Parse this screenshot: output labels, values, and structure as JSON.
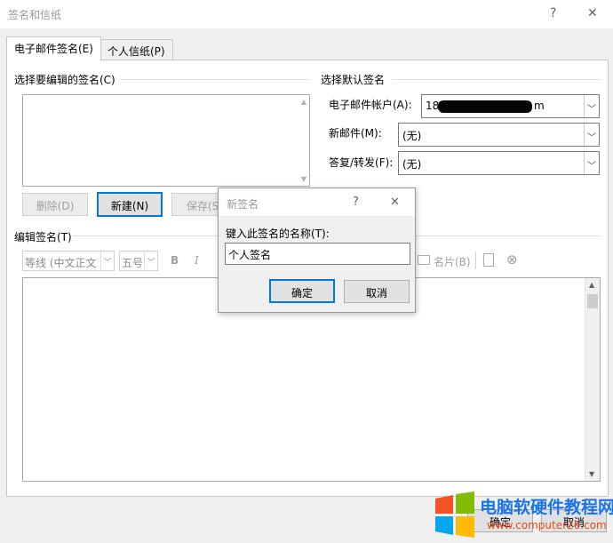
{
  "window": {
    "title": "签名和信纸",
    "help": "?",
    "close": "✕"
  },
  "tabs": [
    {
      "label": "电子邮件签名(E)",
      "active": true
    },
    {
      "label": "个人信纸(P)",
      "active": false
    }
  ],
  "left_section": {
    "heading": "选择要编辑的签名(C)",
    "buttons": {
      "delete": "删除(D)",
      "new": "新建(N)",
      "save": "保存(S"
    }
  },
  "right_section": {
    "heading": "选择默认签名",
    "email_account_label": "电子邮件帐户(A):",
    "email_account_value": "18",
    "email_account_suffix": "m",
    "new_message_label": "新邮件(M):",
    "new_message_value": "(无)",
    "reply_forward_label": "答复/转发(F):",
    "reply_forward_value": "(无)"
  },
  "edit_section": {
    "heading": "编辑签名(T)",
    "font_name": "等线 (中文正文",
    "font_size": "五号",
    "bold": "B",
    "italic": "I",
    "business_card": "名片(B)"
  },
  "bottom_buttons": {
    "ok": "确定",
    "cancel": "取消"
  },
  "modal": {
    "title": "新签名",
    "help": "?",
    "close": "✕",
    "prompt": "键入此签名的名称(T):",
    "input_value": "个人签名",
    "ok": "确定",
    "cancel": "取消"
  },
  "watermark": {
    "line1": "电脑软硬件教程网",
    "line2": "www.computer26.com"
  },
  "colors": {
    "accent": "#0078d7",
    "panel_bg": "#ffffff",
    "window_bg": "#f0f0f0"
  }
}
